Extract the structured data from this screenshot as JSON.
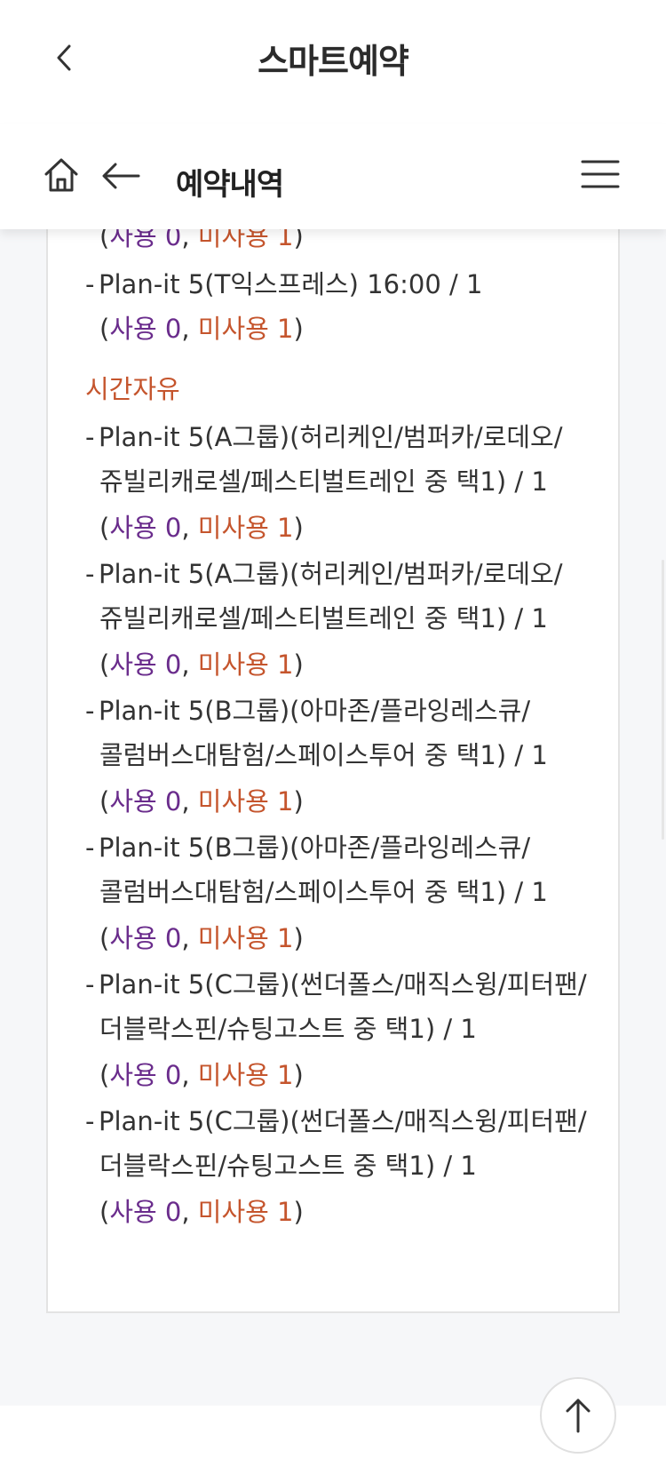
{
  "app": {
    "title": "스마트예약"
  },
  "subheader": {
    "title": "예약내역"
  },
  "paren_open": "(",
  "comma": ",",
  "paren_close": ")",
  "dash": "-",
  "status": {
    "used": "사용 0",
    "unused": "미사용 1"
  },
  "items_top": [
    {
      "text": "Plan-it 5(T익스프레스) 16:00 / 1"
    }
  ],
  "section": {
    "title": "시간자유"
  },
  "items": [
    {
      "line1": "Plan-it 5(A그룹)(허리케인/범퍼카/로데오/",
      "line2": "쥬빌리캐로셀/페스티벌트레인 중 택1) / 1"
    },
    {
      "line1": "Plan-it 5(A그룹)(허리케인/범퍼카/로데오/",
      "line2": "쥬빌리캐로셀/페스티벌트레인 중 택1) / 1"
    },
    {
      "line1": "Plan-it 5(B그룹)(아마존/플라잉레스큐/",
      "line2": "콜럼버스대탐험/스페이스투어 중 택1) / 1"
    },
    {
      "line1": "Plan-it 5(B그룹)(아마존/플라잉레스큐/",
      "line2": "콜럼버스대탐험/스페이스투어 중 택1) / 1"
    },
    {
      "line1": "Plan-it 5(C그룹)(썬더폴스/매직스윙/피터팬/",
      "line2": "더블락스핀/슈팅고스트 중 택1) / 1"
    },
    {
      "line1": "Plan-it 5(C그룹)(썬더폴스/매직스윙/피터팬/",
      "line2": "더블락스핀/슈팅고스트 중 택1) / 1"
    }
  ],
  "colors": {
    "used": "#6a2c8c",
    "unused": "#c5552d"
  },
  "icons": [
    "chevron-left-icon",
    "home-icon",
    "arrow-left-icon",
    "hamburger-menu-icon",
    "arrow-up-icon"
  ]
}
